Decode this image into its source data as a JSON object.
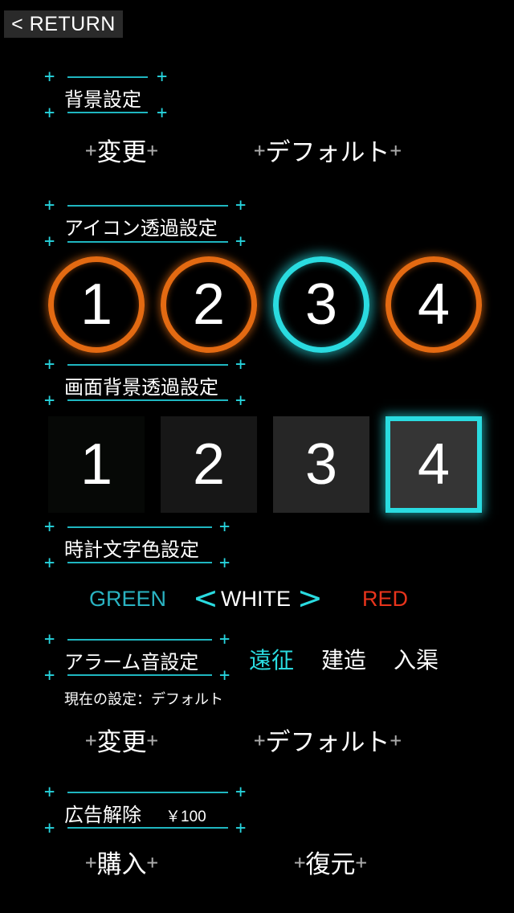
{
  "nav": {
    "return_label": "< RETURN"
  },
  "background_setting": {
    "title": "背景設定",
    "change_label": "変更",
    "default_label": "デフォルト"
  },
  "icon_opacity": {
    "title": "アイコン透過設定",
    "options": [
      "1",
      "2",
      "3",
      "4"
    ],
    "selected": "3",
    "colors": {
      "normal": "#e36a12",
      "selected": "#2adbe0"
    }
  },
  "screen_bg_opacity": {
    "title": "画面背景透過設定",
    "options": [
      "1",
      "2",
      "3",
      "4"
    ],
    "selected": "4",
    "tile_colors": [
      "#060806",
      "#171717",
      "#262626",
      "#353535"
    ]
  },
  "clock_color": {
    "title": "時計文字色設定",
    "left_option": "GREEN",
    "current": "WHITE",
    "right_option": "RED",
    "prev_arrow": "<",
    "next_arrow": ">",
    "colors": {
      "green": "#2ab3c2",
      "red": "#e8341c",
      "arrow": "#2adbe0"
    }
  },
  "alarm_sound": {
    "title": "アラーム音設定",
    "options": [
      "遠征",
      "建造",
      "入渠"
    ],
    "selected": "遠征",
    "current_setting": "現在の設定：デフォルト",
    "change_label": "変更",
    "default_label": "デフォルト"
  },
  "remove_ads": {
    "title": "広告解除",
    "price": "￥100",
    "purchase_label": "購入",
    "restore_label": "復元"
  },
  "accent_color": "#27d3dd"
}
